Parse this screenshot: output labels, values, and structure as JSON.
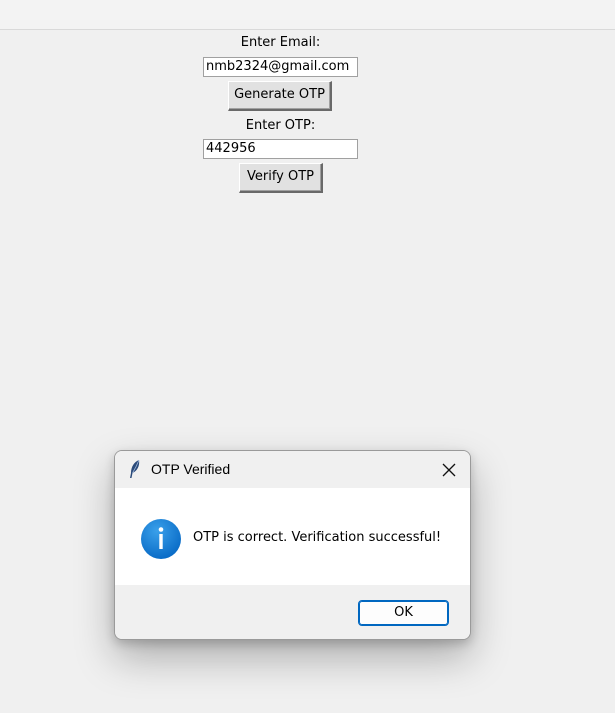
{
  "form": {
    "email_label": "Enter Email:",
    "email_value": "nmb2324@gmail.com",
    "generate_button": "Generate OTP",
    "otp_label": "Enter OTP:",
    "otp_value": "442956",
    "verify_button": "Verify OTP"
  },
  "dialog": {
    "title": "OTP Verified",
    "message": "OTP is correct. Verification successful!",
    "ok_button": "OK",
    "icon": "info-icon",
    "app_icon": "tk-feather-icon",
    "accent_color": "#0067c0"
  }
}
